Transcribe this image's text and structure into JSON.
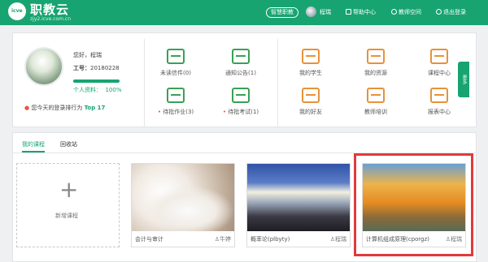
{
  "header": {
    "logo_mark": "icve",
    "title": "职教云",
    "subtitle": "zjy2.icve.com.cn",
    "nav": {
      "smart_button": "智慧职教",
      "user_name": "程瑞",
      "help": "帮助中心",
      "teacher_space": "教师空间",
      "logout": "退出登录"
    }
  },
  "profile": {
    "greeting": "您好，程瑞",
    "id_label": "工号：",
    "id_value": "20180228",
    "completion_label": "个人资料：",
    "completion_value": "100%",
    "rank_text": "您今天的登录排行为",
    "rank_value": "Top 17"
  },
  "quick_links": [
    {
      "label": "未读信件(0)",
      "icon": "mail-icon"
    },
    {
      "label": "通知公告(1)",
      "icon": "speaker-icon"
    },
    {
      "label": "待批作业(3)",
      "icon": "homework-icon"
    },
    {
      "label": "待批考试(1)",
      "icon": "exam-icon"
    }
  ],
  "app_links": [
    {
      "label": "我的学生",
      "icon": "students-icon"
    },
    {
      "label": "我的资源",
      "icon": "resources-icon"
    },
    {
      "label": "课程中心",
      "icon": "course-center-icon"
    },
    {
      "label": "我的好友",
      "icon": "friends-icon"
    },
    {
      "label": "教师培训",
      "icon": "training-icon"
    },
    {
      "label": "报表中心",
      "icon": "report-icon"
    }
  ],
  "side_tab": "更多",
  "tabs": [
    {
      "label": "我的课程",
      "active": true
    },
    {
      "label": "回收站",
      "active": false
    }
  ],
  "new_course": {
    "plus": "+",
    "label": "新增课程"
  },
  "courses": [
    {
      "title": "会计与审计",
      "owner": "牛婷"
    },
    {
      "title": "概率论(plbyty)",
      "owner": "程瑞"
    },
    {
      "title": "计算机组成原理(cporgz)",
      "owner": "程瑞"
    }
  ],
  "colors": {
    "brand": "#17a471",
    "highlight": "#e13a3a"
  }
}
